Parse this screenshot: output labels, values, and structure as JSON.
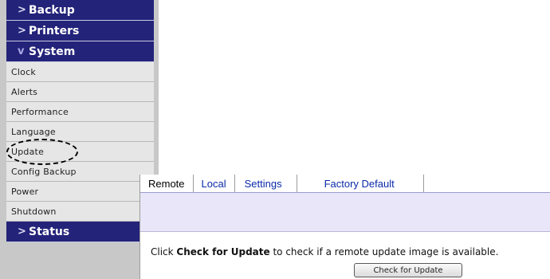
{
  "sidebar": {
    "headers_top": [
      {
        "label": "Backup",
        "chevron": ">"
      },
      {
        "label": "Printers",
        "chevron": ">"
      },
      {
        "label": "System",
        "chevron": "v"
      }
    ],
    "items": [
      {
        "label": "Clock"
      },
      {
        "label": "Alerts"
      },
      {
        "label": "Performance"
      },
      {
        "label": "Language"
      },
      {
        "label": "Update"
      },
      {
        "label": "Config Backup"
      },
      {
        "label": "Power"
      },
      {
        "label": "Shutdown"
      }
    ],
    "header_bottom": {
      "label": "Status",
      "chevron": ">"
    }
  },
  "panel": {
    "tabs": [
      {
        "label": "Remote"
      },
      {
        "label": "Local"
      },
      {
        "label": "Settings"
      },
      {
        "label": "Factory Default"
      }
    ],
    "message_prefix": "Click ",
    "message_bold": "Check for Update",
    "message_suffix": " to check if a remote update image is available.",
    "button_label": "Check for Update"
  },
  "colors": {
    "nav_header_bg": "#23237a",
    "nav_item_bg": "#e6e6e6",
    "tab_link": "#0a2aa8",
    "band_bg": "#e8e6f8"
  }
}
